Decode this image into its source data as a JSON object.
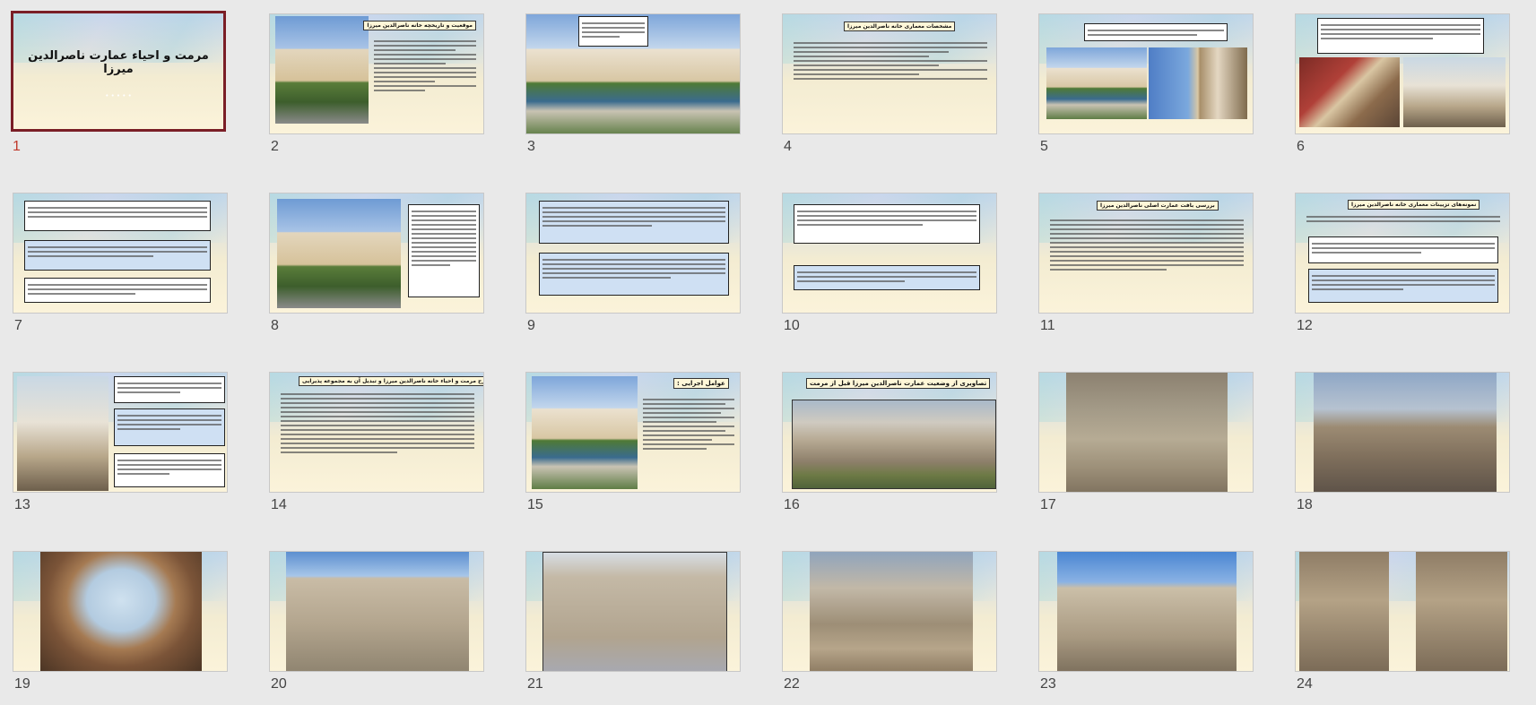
{
  "slides": [
    {
      "number": "1",
      "selected": true,
      "title": "مرمت و احیاء عمارت ناصرالدین میرزا",
      "subtitle": "• • • • •"
    },
    {
      "number": "2",
      "title": "موقعیت و تاریخچه خانه ناصرالدین میرزا"
    },
    {
      "number": "3"
    },
    {
      "number": "4",
      "title": "مشخصات معماری خانه ناصرالدین میرزا"
    },
    {
      "number": "5"
    },
    {
      "number": "6"
    },
    {
      "number": "7"
    },
    {
      "number": "8"
    },
    {
      "number": "9"
    },
    {
      "number": "10"
    },
    {
      "number": "11",
      "title": "بررسی بافت عمارت اصلی ناصرالدین میرزا"
    },
    {
      "number": "12",
      "title": "نمونه‌های تزیینات معماری خانه ناصرالدین میرزا"
    },
    {
      "number": "13"
    },
    {
      "number": "14",
      "title": "طرح مرمت و احیاء خانه ناصرالدین میرزا و تبدیل آن به مجموعه پذیرایی"
    },
    {
      "number": "15",
      "title": "عوامل اجرایی :"
    },
    {
      "number": "16",
      "title": "تصاویری از وضعیت عمارت ناصرالدین میرزا قبل از مرمت"
    },
    {
      "number": "17"
    },
    {
      "number": "18"
    },
    {
      "number": "19"
    },
    {
      "number": "20"
    },
    {
      "number": "21"
    },
    {
      "number": "22"
    },
    {
      "number": "23"
    },
    {
      "number": "24"
    }
  ]
}
